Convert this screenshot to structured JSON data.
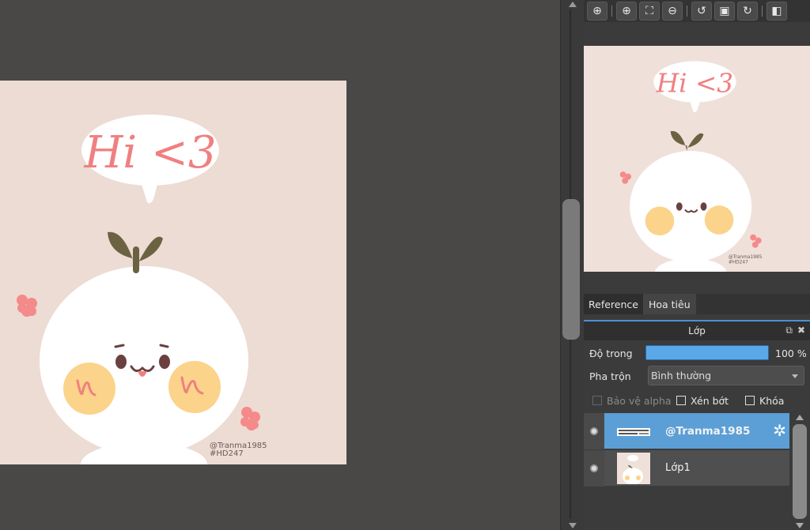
{
  "artwork": {
    "bubble_text": "Hi <3",
    "signature_line1": "@Tranma1985",
    "signature_line2": "#HD247"
  },
  "toolbar": {
    "buttons": [
      {
        "name": "zoom-actual-icon",
        "glyph": "⊕"
      },
      {
        "name": "zoom-in-icon",
        "glyph": "⊕"
      },
      {
        "name": "fit-window-icon",
        "glyph": "⛶"
      },
      {
        "name": "zoom-out-icon",
        "glyph": "⊖"
      },
      {
        "name": "rotate-left-icon",
        "glyph": "↺"
      },
      {
        "name": "reset-view-icon",
        "glyph": "▣"
      },
      {
        "name": "rotate-right-icon",
        "glyph": "↻"
      },
      {
        "name": "flip-horizontal-icon",
        "glyph": "◧"
      }
    ]
  },
  "tabs": [
    {
      "label": "Reference",
      "active": false
    },
    {
      "label": "Hoa tiêu",
      "active": true
    }
  ],
  "layer_panel": {
    "title": "Lớp",
    "opacity_label": "Độ trong",
    "opacity_value": "100 %",
    "opacity_fraction": 1.0,
    "blend_label": "Pha trộn",
    "blend_value": "Bình thường",
    "protect_alpha_label": "Bảo vệ alpha",
    "clipping_label": "Xén bớt",
    "lock_label": "Khóa"
  },
  "layers": [
    {
      "name": "@Tranma1985",
      "selected": true
    },
    {
      "name": "Lớp1",
      "selected": false
    }
  ],
  "colors": {
    "canvas_bg": "#ecdcd4",
    "accent_blue": "#5b9fd6",
    "bubble_text": "#f08080",
    "sprout": "#6b6242",
    "cheek": "#fbd38a"
  }
}
